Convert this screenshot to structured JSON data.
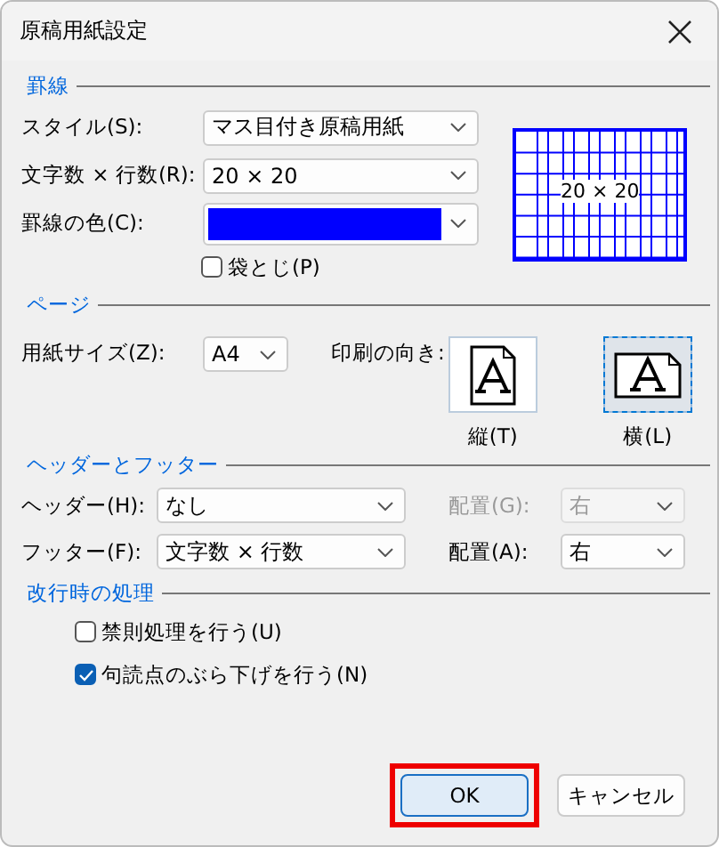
{
  "window": {
    "title": "原稿用紙設定"
  },
  "ruling": {
    "heading": "罫線",
    "style": {
      "label": "スタイル(S):",
      "value": "マス目付き原稿用紙"
    },
    "grid_size": {
      "label": "文字数 × 行数(R):",
      "value": "20 × 20"
    },
    "line_color": {
      "label": "罫線の色(C):",
      "color": "#0000ff"
    },
    "bound": {
      "label": "袋とじ(P)",
      "checked": false
    },
    "preview": {
      "text": "20 × 20"
    }
  },
  "page": {
    "heading": "ページ",
    "paper_size": {
      "label": "用紙サイズ(Z):",
      "value": "A4"
    },
    "orientation_label": "印刷の向き:",
    "orientations": [
      {
        "label": "縦(T)",
        "kind": "portrait",
        "selected": false
      },
      {
        "label": "横(L)",
        "kind": "landscape",
        "selected": true
      }
    ]
  },
  "header_footer": {
    "heading": "ヘッダーとフッター",
    "rows": [
      {
        "label": "ヘッダー(H):",
        "value": "なし",
        "align_label": "配置(G):",
        "align_value": "右",
        "align_disabled": true
      },
      {
        "label": "フッター(F):",
        "value": "文字数 × 行数",
        "align_label": "配置(A):",
        "align_value": "右",
        "align_disabled": false
      }
    ]
  },
  "line_break": {
    "heading": "改行時の処理",
    "options": [
      {
        "label": "禁則処理を行う(U)",
        "checked": false
      },
      {
        "label": "句読点のぶら下げを行う(N)",
        "checked": true
      }
    ]
  },
  "buttons": [
    {
      "label": "OK",
      "default": true,
      "highlighted": true
    },
    {
      "label": "キャンセル",
      "default": false,
      "highlighted": false
    }
  ]
}
